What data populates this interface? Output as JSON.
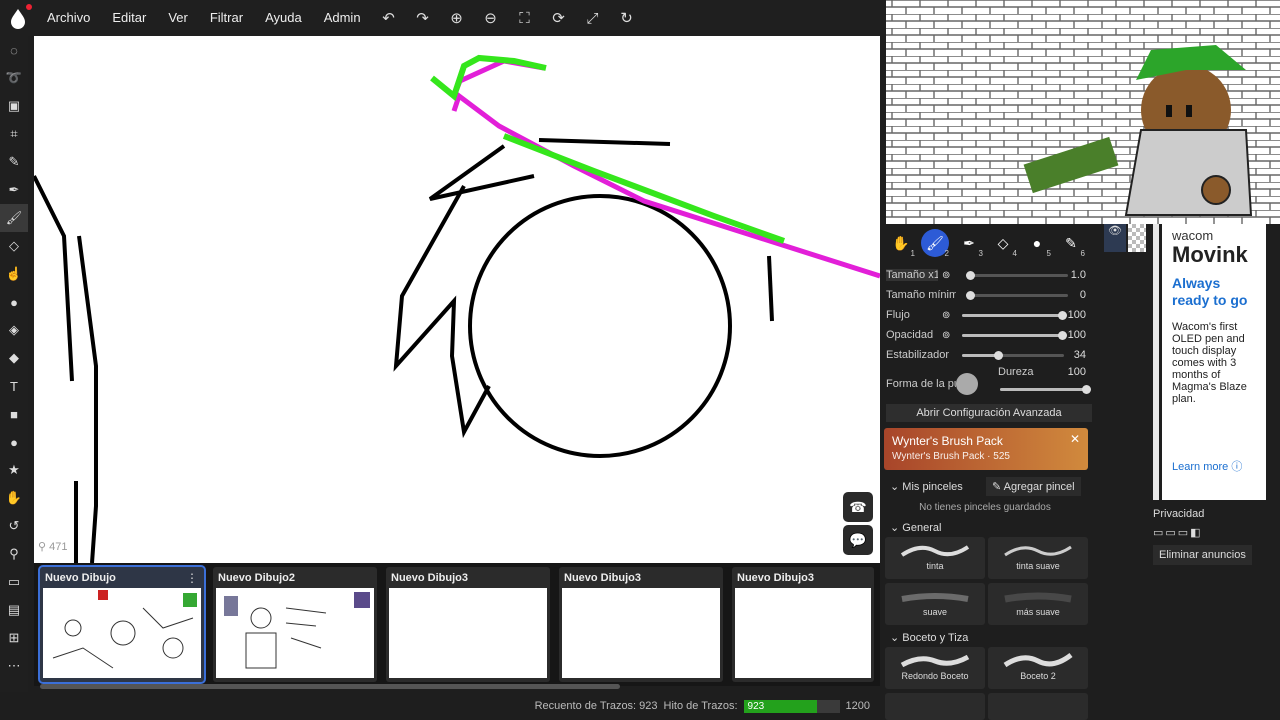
{
  "menu": {
    "items": [
      "Archivo",
      "Editar",
      "Ver",
      "Filtrar",
      "Ayuda",
      "Admin"
    ],
    "toolbar_icons": [
      "undo-icon",
      "redo-icon",
      "zoom-in-icon",
      "zoom-out-icon",
      "fit-icon",
      "rotate-icon",
      "fullscreen-icon",
      "reset-rotate-icon"
    ]
  },
  "tools": [
    "select-circle",
    "lasso",
    "transform",
    "crop",
    "eyedropper",
    "pen",
    "brush",
    "eraser",
    "smudge",
    "blur",
    "fill",
    "paint-bucket",
    "text",
    "rectangle",
    "circle",
    "star",
    "hand",
    "undo",
    "zoom",
    "chat",
    "layers",
    "add",
    "more"
  ],
  "canvas": {
    "zoom_label": "471"
  },
  "drawings": [
    {
      "title": "Nuevo Dibujo",
      "selected": true
    },
    {
      "title": "Nuevo Dibujo2",
      "selected": false
    },
    {
      "title": "Nuevo Dibujo3",
      "selected": false
    },
    {
      "title": "Nuevo Dibujo3",
      "selected": false
    },
    {
      "title": "Nuevo Dibujo3",
      "selected": false
    }
  ],
  "status": {
    "stroke_count_label": "Recuento de Trazos: 923",
    "stroke_limit_label": "Hito de Trazos:",
    "stroke_value": "923",
    "stroke_max": "1200",
    "stroke_fraction": 0.769
  },
  "brush": {
    "tabs": [
      "1",
      "2",
      "3",
      "4",
      "5",
      "6"
    ],
    "params": [
      {
        "label": "Tamaño x1",
        "value": "1.0",
        "level": 0.0
      },
      {
        "label": "Tamaño mínimo",
        "value": "0",
        "level": 0.0
      },
      {
        "label": "Flujo",
        "value": "100",
        "level": 1.0
      },
      {
        "label": "Opacidad",
        "value": "100",
        "level": 1.0
      },
      {
        "label": "Estabilizador",
        "value": "34",
        "level": 0.34
      }
    ],
    "tip_label": "Forma de la punta",
    "hardness_label": "Dureza",
    "hardness_value": "100",
    "advanced_button": "Abrir Configuración Avanzada",
    "promo_title": "Wynter's Brush Pack",
    "promo_subtitle": "Wynter's Brush Pack · 525",
    "my_brushes": "Mis pinceles",
    "add_brush": "Agregar pincel",
    "no_brushes": "No tienes pinceles guardados",
    "general_section": "General",
    "general_brushes": [
      "tinta",
      "tinta suave",
      "suave",
      "más suave"
    ],
    "sketch_section": "Boceto y Tiza",
    "sketch_brushes": [
      "Redondo Boceto",
      "Boceto 2"
    ]
  },
  "ad": {
    "brand": "wacom",
    "product": "Movink",
    "headline": "Always ready to go",
    "body": "Wacom's first OLED pen and touch display comes with 3 months of Magma's Blaze plan.",
    "cta": "Learn more"
  },
  "privacy": {
    "label": "Privacidad",
    "remove_ads": "Eliminar anuncios"
  },
  "colors": {
    "accent": "#2d5bd6",
    "stroke_green": "#23a11c",
    "magenta": "#e21fd8",
    "lime": "#35e61c"
  }
}
